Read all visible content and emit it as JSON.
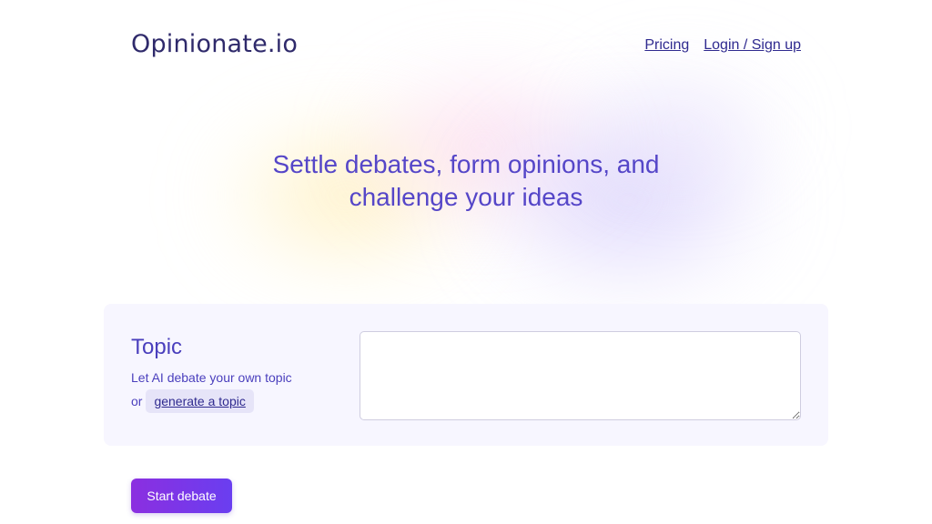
{
  "header": {
    "logo": "Opinionate.io",
    "nav": {
      "pricing": "Pricing",
      "login": "Login / Sign up"
    }
  },
  "hero": {
    "line1": "Settle debates, form opinions, and",
    "line2": "challenge your ideas"
  },
  "topic": {
    "title": "Topic",
    "description": "Let AI debate your own topic",
    "or_label": "or",
    "generate_label": "generate a topic",
    "input_value": "",
    "input_placeholder": ""
  },
  "actions": {
    "start_label": "Start debate"
  },
  "colors": {
    "brand_text": "#2f2a6b",
    "accent": "#5546c8",
    "button_gradient_start": "#8b2fe0",
    "button_gradient_end": "#6a3ef0"
  }
}
